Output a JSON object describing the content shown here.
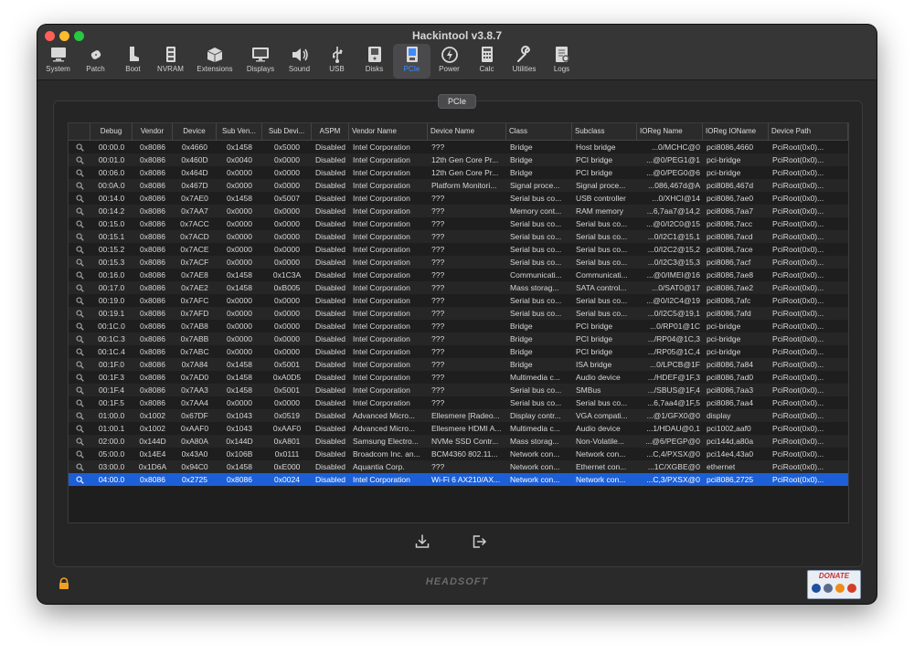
{
  "window": {
    "title": "Hackintool v3.8.7"
  },
  "toolbar": {
    "items": [
      {
        "label": "System",
        "icon": "system-icon"
      },
      {
        "label": "Patch",
        "icon": "patch-icon"
      },
      {
        "label": "Boot",
        "icon": "boot-icon"
      },
      {
        "label": "NVRAM",
        "icon": "nvram-icon"
      },
      {
        "label": "Extensions",
        "icon": "extensions-icon"
      },
      {
        "label": "Displays",
        "icon": "displays-icon"
      },
      {
        "label": "Sound",
        "icon": "sound-icon"
      },
      {
        "label": "USB",
        "icon": "usb-icon"
      },
      {
        "label": "Disks",
        "icon": "disks-icon"
      },
      {
        "label": "PCIe",
        "icon": "pcie-icon",
        "active": true
      },
      {
        "label": "Power",
        "icon": "power-icon"
      },
      {
        "label": "Calc",
        "icon": "calc-icon"
      },
      {
        "label": "Utilities",
        "icon": "utilities-icon"
      },
      {
        "label": "Logs",
        "icon": "logs-icon"
      }
    ]
  },
  "section": {
    "tab_label": "PCIe"
  },
  "table": {
    "columns": [
      "",
      "Debug",
      "Vendor",
      "Device",
      "Sub Ven...",
      "Sub Devi...",
      "ASPM",
      "Vendor Name",
      "Device Name",
      "Class",
      "Subclass",
      "IOReg Name",
      "IOReg IOName",
      "Device Path"
    ],
    "selected_index": 26,
    "rows": [
      [
        "00:00.0",
        "0x8086",
        "0x4660",
        "0x1458",
        "0x5000",
        "Disabled",
        "Intel Corporation",
        "???",
        "Bridge",
        "Host bridge",
        "...0/MCHC@0",
        "pci8086,4660",
        "PciRoot(0x0)..."
      ],
      [
        "00:01.0",
        "0x8086",
        "0x460D",
        "0x0040",
        "0x0000",
        "Disabled",
        "Intel Corporation",
        "12th Gen Core Pr...",
        "Bridge",
        "PCI bridge",
        "...@0/PEG1@1",
        "pci-bridge",
        "PciRoot(0x0)..."
      ],
      [
        "00:06.0",
        "0x8086",
        "0x464D",
        "0x0000",
        "0x0000",
        "Disabled",
        "Intel Corporation",
        "12th Gen Core Pr...",
        "Bridge",
        "PCI bridge",
        "...@0/PEG0@6",
        "pci-bridge",
        "PciRoot(0x0)..."
      ],
      [
        "00:0A.0",
        "0x8086",
        "0x467D",
        "0x0000",
        "0x0000",
        "Disabled",
        "Intel Corporation",
        "Platform Monitori...",
        "Signal proce...",
        "Signal proce...",
        "...086,467d@A",
        "pci8086,467d",
        "PciRoot(0x0)..."
      ],
      [
        "00:14.0",
        "0x8086",
        "0x7AE0",
        "0x1458",
        "0x5007",
        "Disabled",
        "Intel Corporation",
        "???",
        "Serial bus co...",
        "USB controller",
        "...0/XHCI@14",
        "pci8086,7ae0",
        "PciRoot(0x0)..."
      ],
      [
        "00:14.2",
        "0x8086",
        "0x7AA7",
        "0x0000",
        "0x0000",
        "Disabled",
        "Intel Corporation",
        "???",
        "Memory cont...",
        "RAM memory",
        "...6,7aa7@14,2",
        "pci8086,7aa7",
        "PciRoot(0x0)..."
      ],
      [
        "00:15.0",
        "0x8086",
        "0x7ACC",
        "0x0000",
        "0x0000",
        "Disabled",
        "Intel Corporation",
        "???",
        "Serial bus co...",
        "Serial bus co...",
        "...@0/I2C0@15",
        "pci8086,7acc",
        "PciRoot(0x0)..."
      ],
      [
        "00:15.1",
        "0x8086",
        "0x7ACD",
        "0x0000",
        "0x0000",
        "Disabled",
        "Intel Corporation",
        "???",
        "Serial bus co...",
        "Serial bus co...",
        "...0/I2C1@15,1",
        "pci8086,7acd",
        "PciRoot(0x0)..."
      ],
      [
        "00:15.2",
        "0x8086",
        "0x7ACE",
        "0x0000",
        "0x0000",
        "Disabled",
        "Intel Corporation",
        "???",
        "Serial bus co...",
        "Serial bus co...",
        "...0/I2C2@15,2",
        "pci8086,7ace",
        "PciRoot(0x0)..."
      ],
      [
        "00:15.3",
        "0x8086",
        "0x7ACF",
        "0x0000",
        "0x0000",
        "Disabled",
        "Intel Corporation",
        "???",
        "Serial bus co...",
        "Serial bus co...",
        "...0/I2C3@15,3",
        "pci8086,7acf",
        "PciRoot(0x0)..."
      ],
      [
        "00:16.0",
        "0x8086",
        "0x7AE8",
        "0x1458",
        "0x1C3A",
        "Disabled",
        "Intel Corporation",
        "???",
        "Communicati...",
        "Communicati...",
        "...@0/IMEI@16",
        "pci8086,7ae8",
        "PciRoot(0x0)..."
      ],
      [
        "00:17.0",
        "0x8086",
        "0x7AE2",
        "0x1458",
        "0xB005",
        "Disabled",
        "Intel Corporation",
        "???",
        "Mass storag...",
        "SATA control...",
        "...0/SAT0@17",
        "pci8086,7ae2",
        "PciRoot(0x0)..."
      ],
      [
        "00:19.0",
        "0x8086",
        "0x7AFC",
        "0x0000",
        "0x0000",
        "Disabled",
        "Intel Corporation",
        "???",
        "Serial bus co...",
        "Serial bus co...",
        "...@0/I2C4@19",
        "pci8086,7afc",
        "PciRoot(0x0)..."
      ],
      [
        "00:19.1",
        "0x8086",
        "0x7AFD",
        "0x0000",
        "0x0000",
        "Disabled",
        "Intel Corporation",
        "???",
        "Serial bus co...",
        "Serial bus co...",
        "...0/I2C5@19,1",
        "pci8086,7afd",
        "PciRoot(0x0)..."
      ],
      [
        "00:1C.0",
        "0x8086",
        "0x7AB8",
        "0x0000",
        "0x0000",
        "Disabled",
        "Intel Corporation",
        "???",
        "Bridge",
        "PCI bridge",
        "...0/RP01@1C",
        "pci-bridge",
        "PciRoot(0x0)..."
      ],
      [
        "00:1C.3",
        "0x8086",
        "0x7ABB",
        "0x0000",
        "0x0000",
        "Disabled",
        "Intel Corporation",
        "???",
        "Bridge",
        "PCI bridge",
        ".../RP04@1C,3",
        "pci-bridge",
        "PciRoot(0x0)..."
      ],
      [
        "00:1C.4",
        "0x8086",
        "0x7ABC",
        "0x0000",
        "0x0000",
        "Disabled",
        "Intel Corporation",
        "???",
        "Bridge",
        "PCI bridge",
        ".../RP05@1C,4",
        "pci-bridge",
        "PciRoot(0x0)..."
      ],
      [
        "00:1F.0",
        "0x8086",
        "0x7A84",
        "0x1458",
        "0x5001",
        "Disabled",
        "Intel Corporation",
        "???",
        "Bridge",
        "ISA bridge",
        "...0/LPCB@1F",
        "pci8086,7a84",
        "PciRoot(0x0)..."
      ],
      [
        "00:1F.3",
        "0x8086",
        "0x7AD0",
        "0x1458",
        "0xA0D5",
        "Disabled",
        "Intel Corporation",
        "???",
        "Multimedia c...",
        "Audio device",
        ".../HDEF@1F,3",
        "pci8086,7ad0",
        "PciRoot(0x0)..."
      ],
      [
        "00:1F.4",
        "0x8086",
        "0x7AA3",
        "0x1458",
        "0x5001",
        "Disabled",
        "Intel Corporation",
        "???",
        "Serial bus co...",
        "SMBus",
        ".../SBUS@1F,4",
        "pci8086,7aa3",
        "PciRoot(0x0)..."
      ],
      [
        "00:1F.5",
        "0x8086",
        "0x7AA4",
        "0x0000",
        "0x0000",
        "Disabled",
        "Intel Corporation",
        "???",
        "Serial bus co...",
        "Serial bus co...",
        "...6,7aa4@1F,5",
        "pci8086,7aa4",
        "PciRoot(0x0)..."
      ],
      [
        "01:00.0",
        "0x1002",
        "0x67DF",
        "0x1043",
        "0x0519",
        "Disabled",
        "Advanced Micro...",
        "Ellesmere [Radeo...",
        "Display contr...",
        "VGA compati...",
        "...@1/GFX0@0",
        "display",
        "PciRoot(0x0)..."
      ],
      [
        "01:00.1",
        "0x1002",
        "0xAAF0",
        "0x1043",
        "0xAAF0",
        "Disabled",
        "Advanced Micro...",
        "Ellesmere HDMI A...",
        "Multimedia c...",
        "Audio device",
        "...1/HDAU@0,1",
        "pci1002,aaf0",
        "PciRoot(0x0)..."
      ],
      [
        "02:00.0",
        "0x144D",
        "0xA80A",
        "0x144D",
        "0xA801",
        "Disabled",
        "Samsung Electro...",
        "NVMe SSD Contr...",
        "Mass storag...",
        "Non-Volatile...",
        "...@6/PEGP@0",
        "pci144d,a80a",
        "PciRoot(0x0)..."
      ],
      [
        "05:00.0",
        "0x14E4",
        "0x43A0",
        "0x106B",
        "0x0111",
        "Disabled",
        "Broadcom Inc. an...",
        "BCM4360 802.11...",
        "Network con...",
        "Network con...",
        "...C,4/PXSX@0",
        "pci14e4,43a0",
        "PciRoot(0x0)..."
      ],
      [
        "03:00.0",
        "0x1D6A",
        "0x94C0",
        "0x1458",
        "0xE000",
        "Disabled",
        "Aquantia Corp.",
        "???",
        "Network con...",
        "Ethernet con...",
        "...1C/XGBE@0",
        "ethernet",
        "PciRoot(0x0)..."
      ],
      [
        "04:00.0",
        "0x8086",
        "0x2725",
        "0x8086",
        "0x0024",
        "Disabled",
        "Intel Corporation",
        "Wi-Fi 6 AX210/AX...",
        "Network con...",
        "Network con...",
        "...C,3/PXSX@0",
        "pci8086,2725",
        "PciRoot(0x0)..."
      ]
    ]
  },
  "footer": {
    "brand": "HEADSOFT",
    "donate_label": "DONATE",
    "export_icon": "export-icon",
    "exit_icon": "exit-icon",
    "lock_icon": "lock-icon"
  },
  "colors": {
    "accent": "#3d8bff",
    "selection": "#1c5fd6",
    "window_bg": "#2a2a2b"
  }
}
